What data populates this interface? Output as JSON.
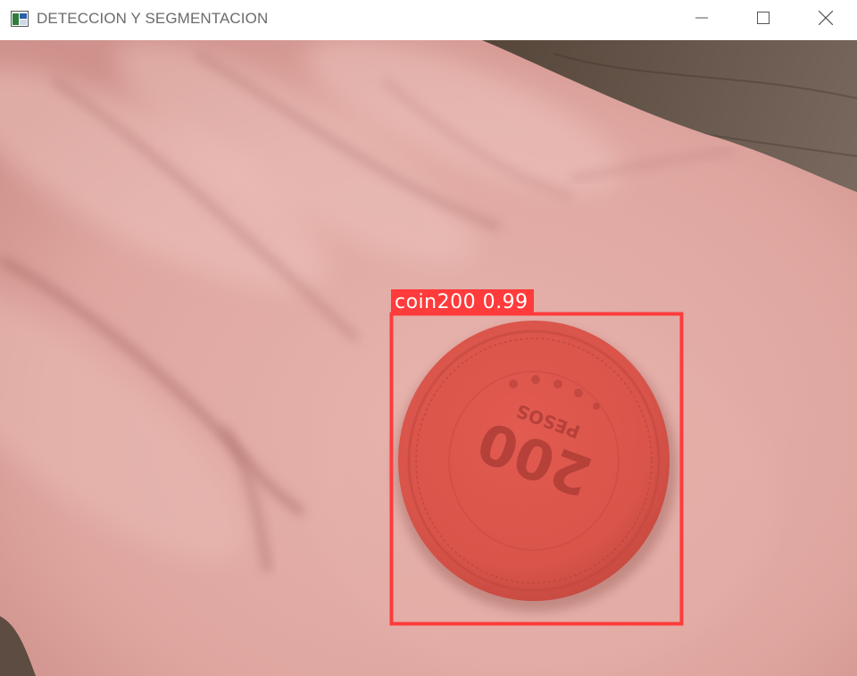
{
  "window": {
    "title": "DETECCION Y SEGMENTACION",
    "icon": "app-window-icon",
    "controls": {
      "minimize_icon": "minimize-icon",
      "maximize_icon": "maximize-icon",
      "close_icon": "close-icon"
    }
  },
  "detection": {
    "class_name": "coin200",
    "confidence": "0.99",
    "label_text": "coin200 0.99",
    "box_color": "#ff3b3b",
    "mask_color": "#e8574d"
  },
  "coin": {
    "denomination_text": "200",
    "currency_text": "PESOS"
  },
  "colors": {
    "skin": "#e0aaa4",
    "skin_shadow": "#b97a76",
    "wood": "#5a4a40"
  }
}
